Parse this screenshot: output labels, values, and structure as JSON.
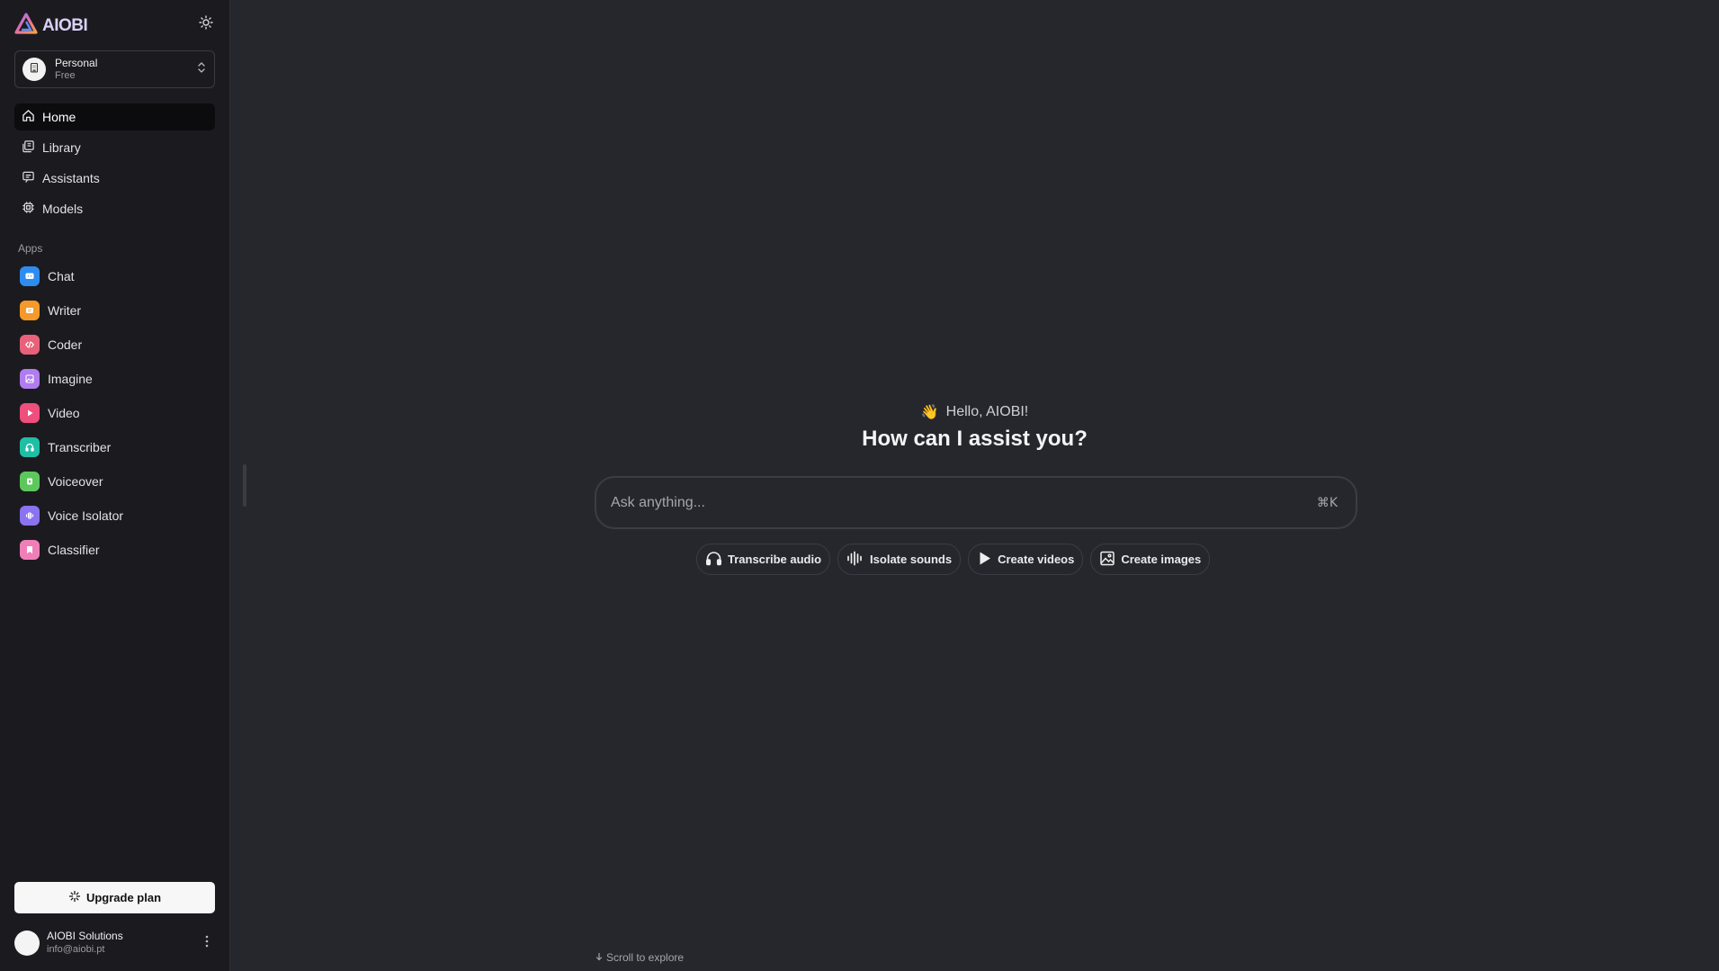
{
  "brand": {
    "name": "AIOBI"
  },
  "workspace": {
    "name": "Personal",
    "plan": "Free"
  },
  "nav": [
    {
      "label": "Home",
      "icon": "home-icon",
      "active": true
    },
    {
      "label": "Library",
      "icon": "library-icon"
    },
    {
      "label": "Assistants",
      "icon": "assistants-icon"
    },
    {
      "label": "Models",
      "icon": "models-icon"
    }
  ],
  "apps": {
    "label": "Apps",
    "items": [
      {
        "label": "Chat",
        "color": "#2d8cf0"
      },
      {
        "label": "Writer",
        "color": "#f59a2a"
      },
      {
        "label": "Coder",
        "color": "#e8617a"
      },
      {
        "label": "Imagine",
        "color": "#b07cf0"
      },
      {
        "label": "Video",
        "color": "#ee4f7c"
      },
      {
        "label": "Transcriber",
        "color": "#1fbfa6"
      },
      {
        "label": "Voiceover",
        "color": "#5cc85c"
      },
      {
        "label": "Voice Isolator",
        "color": "#8b72f0"
      },
      {
        "label": "Classifier",
        "color": "#f07fb8"
      }
    ]
  },
  "upgrade": {
    "label": "Upgrade plan"
  },
  "user": {
    "name": "AIOBI Solutions",
    "email": "info@aiobi.pt"
  },
  "hero": {
    "greeting": "Hello, AIOBI!",
    "emoji": "👋",
    "question": "How can I assist you?"
  },
  "ask": {
    "placeholder": "Ask anything...",
    "shortcut": "⌘K"
  },
  "chips": [
    {
      "label": "Transcribe audio",
      "icon": "headphones-icon"
    },
    {
      "label": "Isolate sounds",
      "icon": "waveform-icon"
    },
    {
      "label": "Create videos",
      "icon": "play-icon"
    },
    {
      "label": "Create images",
      "icon": "image-icon"
    }
  ],
  "scroll_hint": "Scroll to explore"
}
